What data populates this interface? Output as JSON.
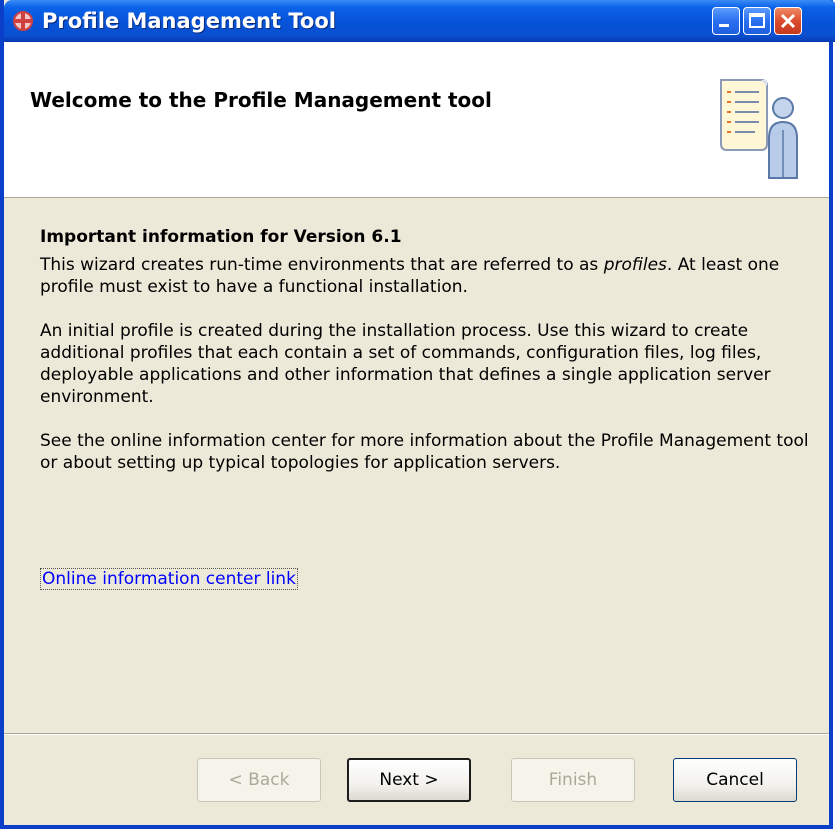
{
  "window": {
    "title": "Profile Management Tool",
    "icon": "app-cross-icon",
    "controls": [
      "minimize-icon",
      "maximize-icon",
      "close-icon"
    ]
  },
  "banner": {
    "title": "Welcome to the Profile Management tool",
    "image": "document-person-icon"
  },
  "content": {
    "heading": "Important information for Version 6.1",
    "para1_before": "This wizard creates run-time environments that are referred to as ",
    "para1_emph": "profiles",
    "para1_after": ". At least one profile must exist to have a functional installation.",
    "para2": "An initial profile is created during the installation process. Use this wizard to create additional profiles that each contain a set of commands, configuration files, log files, deployable applications and other information that defines a single application server environment.",
    "para3": "See the online information center for more information about the Profile Management tool or about setting up typical topologies for application servers.",
    "link": "Online information center link"
  },
  "buttons": {
    "back": "< Back",
    "next": "Next >",
    "finish": "Finish",
    "cancel": "Cancel"
  },
  "colors": {
    "titlebar": "#0a62e8",
    "dialog_bg": "#ece9d8",
    "link": "#0000ff"
  }
}
